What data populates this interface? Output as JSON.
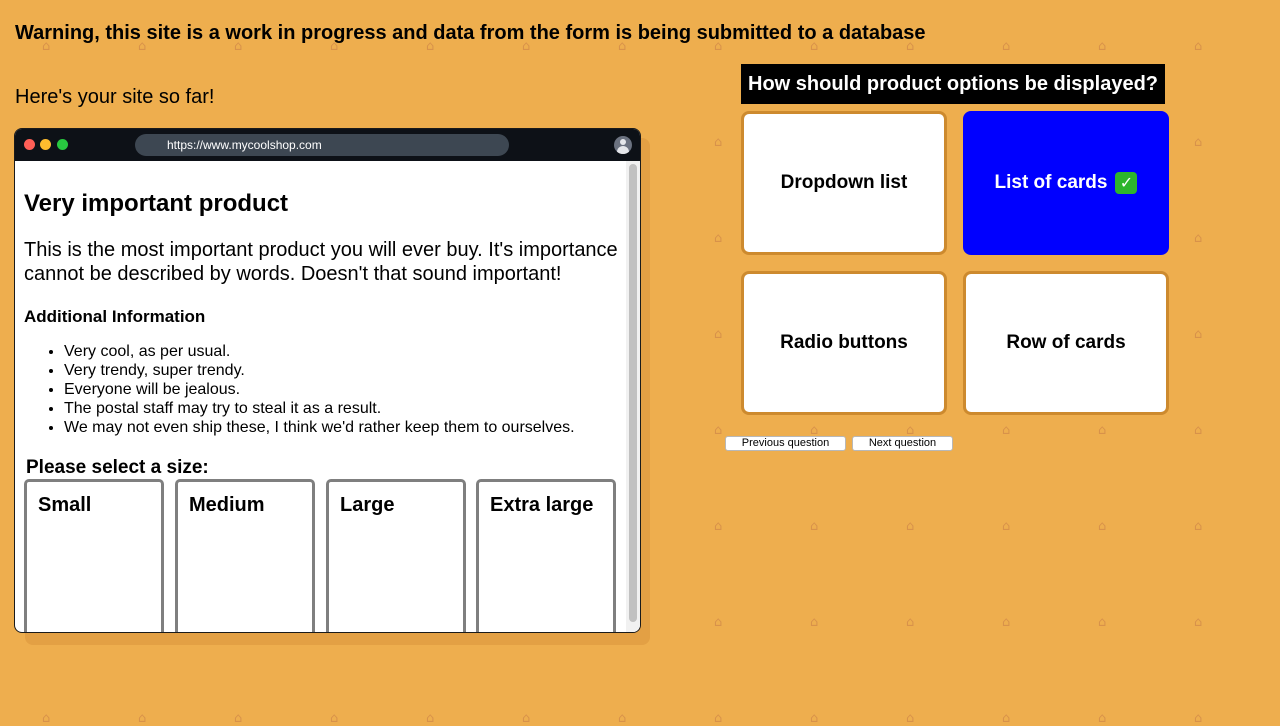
{
  "page": {
    "warning": "Warning, this site is a work in progress and data from the form is being submitted to a database",
    "intro": "Here's your site so far!",
    "background_color": "#eeae4e",
    "background_icon": "basket-icon"
  },
  "browser": {
    "url": "https://www.mycoolshop.com",
    "dots": [
      "#ff5f57",
      "#febc2e",
      "#28c840"
    ],
    "product": {
      "title": "Very important product",
      "description": "This is the most important product you will ever buy. It's importance cannot be described by words. Doesn't that sound important!",
      "additional_heading": "Additional Information",
      "info_items": [
        "Very cool, as per usual.",
        "Very trendy, super trendy.",
        "Everyone will be jealous.",
        "The postal staff may try to steal it as a result.",
        "We may not even ship these, I think we'd rather keep them to ourselves."
      ],
      "size_label": "Please select a size:",
      "sizes": [
        "Small",
        "Medium",
        "Large",
        "Extra large"
      ]
    }
  },
  "quiz": {
    "question": "How should product options be displayed?",
    "options": [
      "Dropdown list",
      "List of cards",
      "Radio buttons",
      "Row of cards"
    ],
    "selected": "List of cards",
    "selected_color": "#0000ff",
    "check_icon": "check-mark-icon",
    "prev_label": "Previous question",
    "next_label": "Next question"
  }
}
